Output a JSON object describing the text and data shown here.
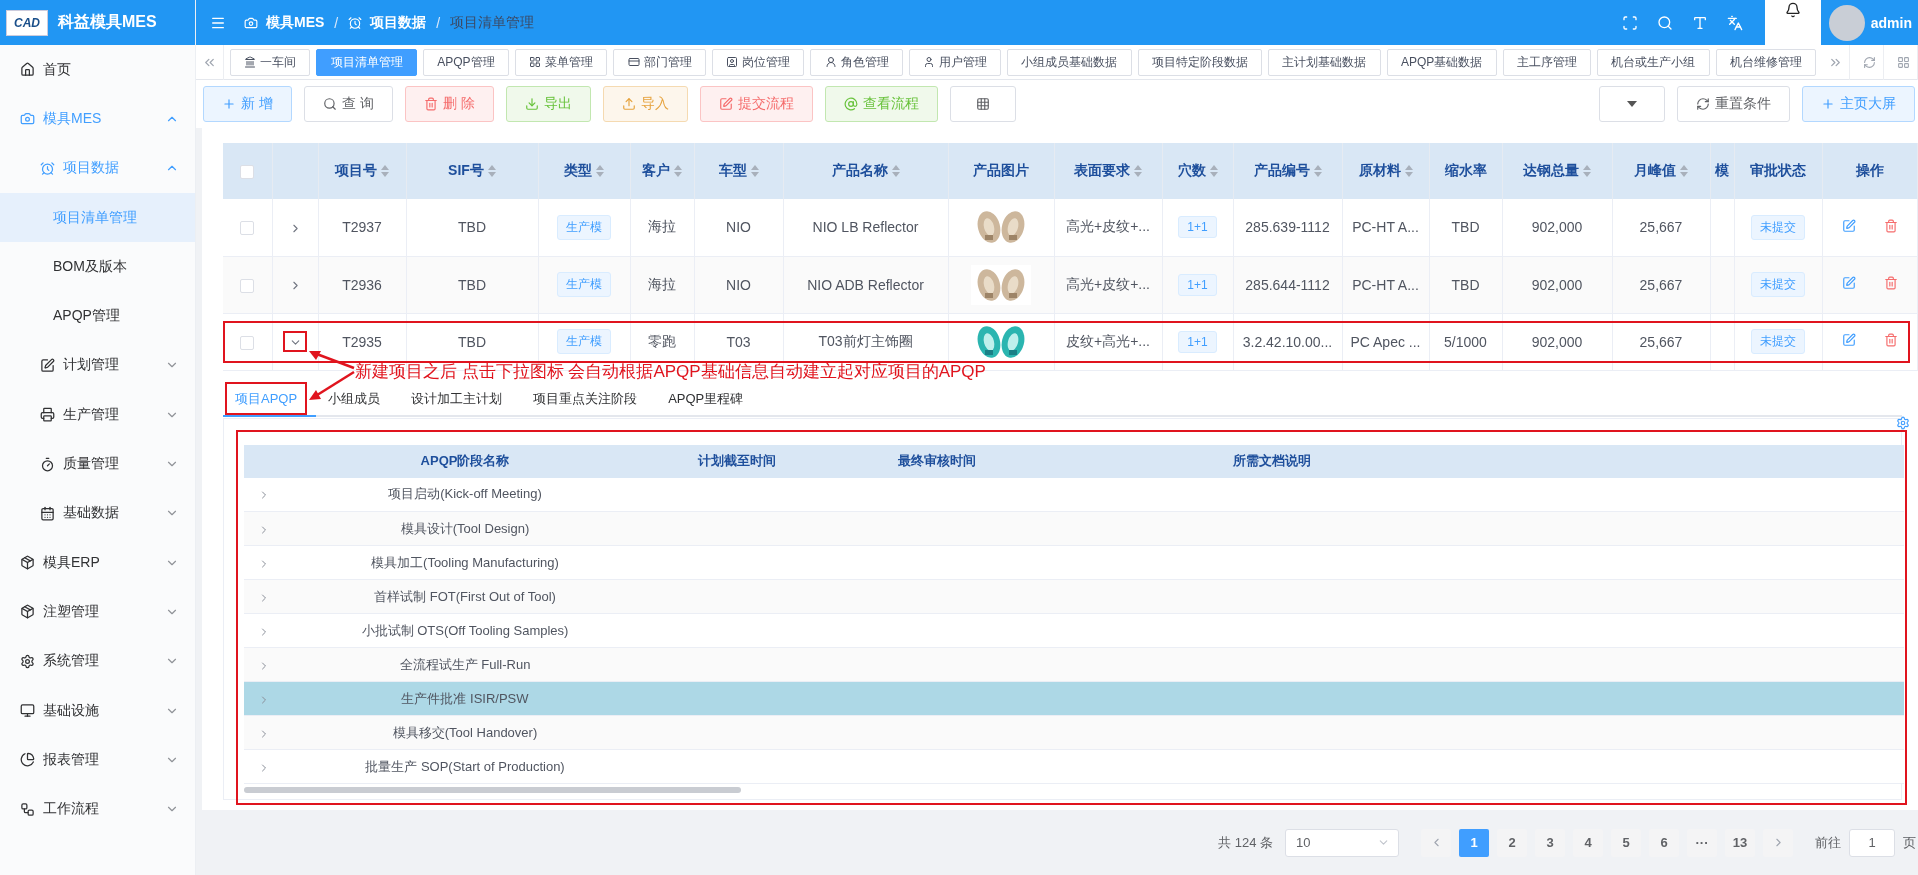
{
  "app": {
    "logo_text": "CAD",
    "title": "科益模具MES"
  },
  "sidebar": {
    "items": [
      {
        "label": "首页",
        "selected": false
      },
      {
        "label": "模具MES",
        "selected": false,
        "expanded": true,
        "children": [
          {
            "label": "项目数据",
            "selected": false,
            "expanded": true,
            "children": [
              {
                "label": "项目清单管理",
                "selected": true
              },
              {
                "label": "BOM及版本",
                "selected": false
              },
              {
                "label": "APQP管理",
                "selected": false
              }
            ]
          },
          {
            "label": "计划管理",
            "selected": false,
            "expanded": false
          },
          {
            "label": "生产管理",
            "selected": false,
            "expanded": false
          },
          {
            "label": "质量管理",
            "selected": false,
            "expanded": false
          },
          {
            "label": "基础数据",
            "selected": false,
            "expanded": false
          }
        ]
      },
      {
        "label": "模具ERP",
        "selected": false,
        "expanded": false
      },
      {
        "label": "注塑管理",
        "selected": false,
        "expanded": false
      },
      {
        "label": "系统管理",
        "selected": false,
        "expanded": false
      },
      {
        "label": "基础设施",
        "selected": false,
        "expanded": false
      },
      {
        "label": "报表管理",
        "selected": false,
        "expanded": false
      },
      {
        "label": "工作流程",
        "selected": false,
        "expanded": false
      }
    ]
  },
  "header": {
    "breadcrumb": [
      {
        "label": "模具MES"
      },
      {
        "separator": "/",
        "label": "项目数据"
      },
      {
        "separator": "/",
        "label": "项目清单管理"
      }
    ],
    "user": "admin"
  },
  "tabs": [
    {
      "label": "一车间",
      "selected": false
    },
    {
      "label": "项目清单管理",
      "selected": true
    },
    {
      "label": "APQP管理",
      "selected": false
    },
    {
      "label": "菜单管理",
      "selected": false
    },
    {
      "label": "部门管理",
      "selected": false
    },
    {
      "label": "岗位管理",
      "selected": false
    },
    {
      "label": "角色管理",
      "selected": false
    },
    {
      "label": "用户管理",
      "selected": false
    },
    {
      "label": "小组成员基础数据",
      "selected": false
    },
    {
      "label": "项目特定阶段数据",
      "selected": false
    },
    {
      "label": "主计划基础数据",
      "selected": false
    },
    {
      "label": "APQP基础数据",
      "selected": false
    },
    {
      "label": "主工序管理",
      "selected": false
    },
    {
      "label": "机台或生产小组",
      "selected": false
    },
    {
      "label": "机台维修管理",
      "selected": false
    }
  ],
  "toolbar": {
    "left": [
      {
        "label": "新 增",
        "kind": "primary"
      },
      {
        "label": "查 询",
        "kind": "default"
      },
      {
        "label": "删 除",
        "kind": "danger"
      },
      {
        "label": "导出",
        "kind": "success"
      },
      {
        "label": "导入",
        "kind": "warning"
      },
      {
        "label": "提交流程",
        "kind": "danger"
      },
      {
        "label": "查看流程",
        "kind": "success"
      }
    ],
    "right": [
      {
        "label": "重置条件",
        "kind": "default"
      },
      {
        "label": "主页大屏",
        "kind": "primary"
      }
    ]
  },
  "table": {
    "all_checked": false,
    "columns": [
      {
        "label": "项目号",
        "kind": "text",
        "sortable": true
      },
      {
        "label": "SIF号",
        "kind": "text",
        "sortable": true
      },
      {
        "label": "类型",
        "kind": "tag",
        "sortable": true
      },
      {
        "label": "客户",
        "kind": "text",
        "sortable": true
      },
      {
        "label": "车型",
        "kind": "text",
        "sortable": true
      },
      {
        "label": "产品名称",
        "kind": "text",
        "sortable": true
      },
      {
        "label": "产品图片",
        "kind": "picture",
        "sortable": false
      },
      {
        "label": "表面要求",
        "kind": "text",
        "sortable": true
      },
      {
        "label": "穴数",
        "kind": "tag",
        "sortable": true
      },
      {
        "label": "产品编号",
        "kind": "text",
        "sortable": true
      },
      {
        "label": "原材料",
        "kind": "text",
        "sortable": true
      },
      {
        "label": "缩水率",
        "kind": "text",
        "sortable": false
      },
      {
        "label": "达钢总量",
        "kind": "text",
        "sortable": true
      },
      {
        "label": "月峰值",
        "kind": "text",
        "sortable": true
      },
      {
        "label": "模",
        "kind": "empty",
        "sortable": false
      },
      {
        "label": "审批状态",
        "kind": "tag",
        "sortable": false
      },
      {
        "label": "操作",
        "kind": "actions",
        "sortable": false
      }
    ],
    "rows": [
      {
        "checked": false,
        "expanded": false,
        "cells": [
          "T2937",
          "TBD",
          "生产模",
          "海拉",
          "NIO",
          "NIO LB Reflector",
          "",
          "高光+皮纹+...",
          "1+1",
          "285.639-1112",
          "PC-HT A...",
          "TBD",
          "902,000",
          "25,667",
          "",
          "未提交",
          ""
        ]
      },
      {
        "checked": false,
        "expanded": false,
        "cells": [
          "T2936",
          "TBD",
          "生产模",
          "海拉",
          "NIO",
          "NIO ADB Reflector",
          "",
          "高光+皮纹+...",
          "1+1",
          "285.644-1112",
          "PC-HT A...",
          "TBD",
          "902,000",
          "25,667",
          "",
          "未提交",
          ""
        ]
      },
      {
        "checked": false,
        "expanded": true,
        "cells": [
          "T2935",
          "TBD",
          "生产模",
          "零跑",
          "T03",
          "T03前灯主饰圈",
          "",
          "皮纹+高光+...",
          "1+1",
          "3.2.42.10.00...",
          "PC Apec ...",
          "5/1000",
          "902,000",
          "25,667",
          "",
          "未提交",
          ""
        ]
      }
    ]
  },
  "annotation": {
    "text": "新建项目之后 点击下拉图标 会自动根据APQP基础信息自动建立起对应项目的APQP"
  },
  "sub_tabs": [
    {
      "label": "项目APQP",
      "selected": true
    },
    {
      "label": "小组成员",
      "selected": false
    },
    {
      "label": "设计加工主计划",
      "selected": false
    },
    {
      "label": "项目重点关注阶段",
      "selected": false
    },
    {
      "label": "APQP里程碑",
      "selected": false
    }
  ],
  "apqp_table": {
    "columns": [
      "APQP阶段名称",
      "计划截至时间",
      "最终审核时间",
      "所需文档说明"
    ],
    "rows": [
      {
        "name": "项目启动(Kick-off Meeting)",
        "selected": false
      },
      {
        "name": "模具设计(Tool Design)",
        "selected": false
      },
      {
        "name": "模具加工(Tooling Manufacturing)",
        "selected": false
      },
      {
        "name": "首样试制 FOT(First Out of Tool)",
        "selected": false
      },
      {
        "name": "小批试制 OTS(Off Tooling Samples)",
        "selected": false
      },
      {
        "name": "全流程试生产 Full-Run",
        "selected": false
      },
      {
        "name": "生产件批准 ISIR/PSW",
        "selected": true
      },
      {
        "name": "模具移交(Tool Handover)",
        "selected": false
      },
      {
        "name": "批量生产 SOP(Start of Production)",
        "selected": false
      }
    ]
  },
  "pagination": {
    "total": "共 124 条",
    "page_size": "10",
    "pages": [
      {
        "label": "1",
        "selected": true
      },
      {
        "label": "2",
        "selected": false
      },
      {
        "label": "3",
        "selected": false
      },
      {
        "label": "4",
        "selected": false
      },
      {
        "label": "5",
        "selected": false
      },
      {
        "label": "6",
        "selected": false
      },
      {
        "label": "···",
        "selected": false
      },
      {
        "label": "13",
        "selected": false
      }
    ],
    "goto_label": "前往",
    "goto_value": "1",
    "page_suffix": "页"
  }
}
